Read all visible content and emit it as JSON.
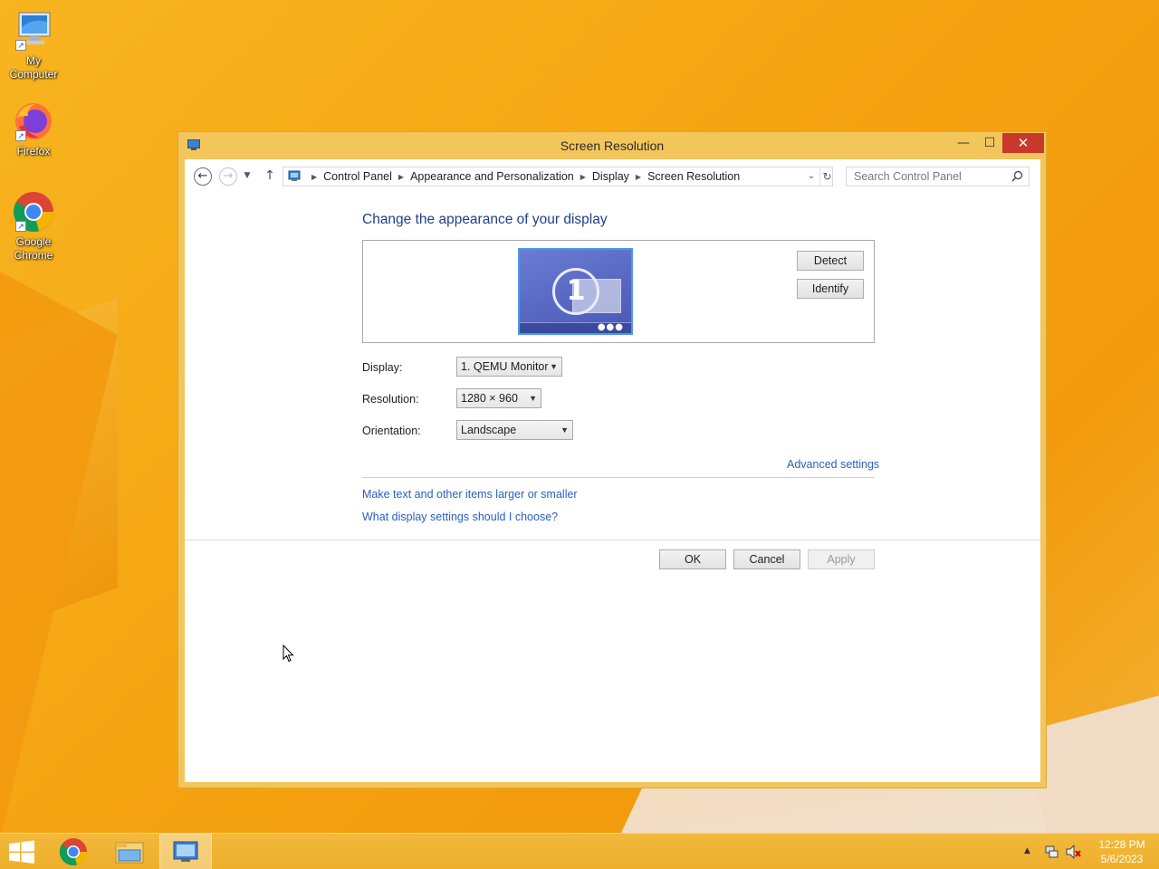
{
  "desktop": {
    "icons": [
      {
        "label_line1": "My",
        "label_line2": "Computer"
      },
      {
        "label_line1": "Firefox",
        "label_line2": ""
      },
      {
        "label_line1": "Google",
        "label_line2": "Chrome"
      }
    ]
  },
  "window": {
    "title": "Screen Resolution",
    "controls": {
      "minimize": "—",
      "maximize": "☐",
      "close": "✕"
    }
  },
  "navbar": {
    "breadcrumbs": [
      "Control Panel",
      "Appearance and Personalization",
      "Display",
      "Screen Resolution"
    ],
    "search_placeholder": "Search Control Panel"
  },
  "content": {
    "heading": "Change the appearance of your display",
    "monitor_number": "1",
    "detect_label": "Detect",
    "identify_label": "Identify",
    "display_label": "Display:",
    "display_value": "1. QEMU Monitor",
    "resolution_label": "Resolution:",
    "resolution_value": "1280 × 960",
    "orientation_label": "Orientation:",
    "orientation_value": "Landscape",
    "advanced_link": "Advanced settings",
    "link_text_size": "Make text and other items larger or smaller",
    "link_help": "What display settings should I choose?",
    "ok_label": "OK",
    "cancel_label": "Cancel",
    "apply_label": "Apply"
  },
  "taskbar": {
    "time": "12:28 PM",
    "date": "5/6/2023"
  },
  "colors": {
    "accent_link": "#2a5fbd",
    "heading": "#1e3f8a",
    "window_frame": "#f3c65c",
    "close_button": "#c7392b"
  }
}
